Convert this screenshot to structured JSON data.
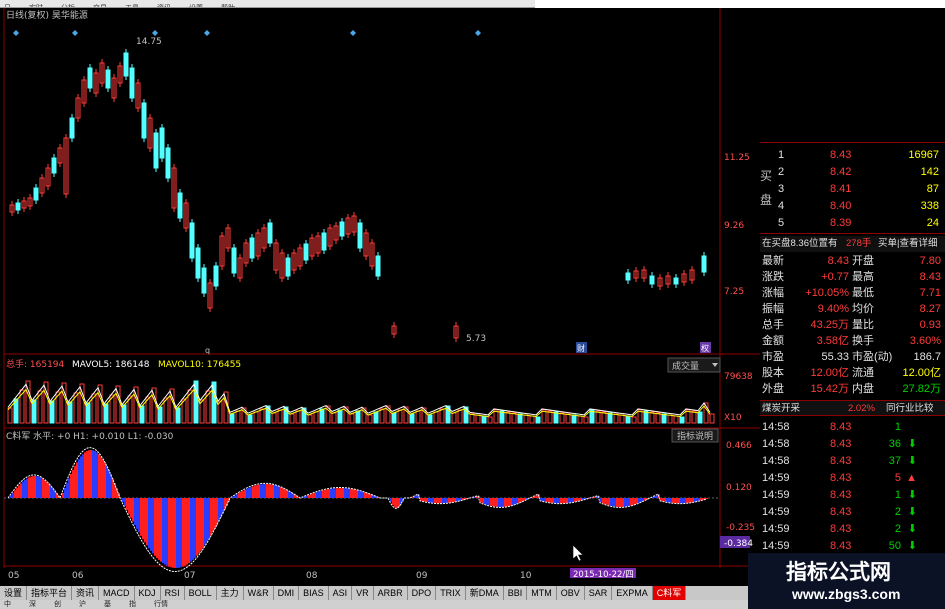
{
  "top_menu": [
    "日",
    "实时",
    "分析",
    "交易",
    "工具",
    "资讯",
    "设置",
    "帮助"
  ],
  "chart_header": {
    "title": "日线(复权) 昊华能源"
  },
  "price_labels": {
    "high": "14.75",
    "low": "5.73",
    "p1": "11.25",
    "p2": "9.26",
    "p3": "7.25"
  },
  "markers": {
    "q": "q",
    "cai": "财",
    "quan": "权"
  },
  "volume": {
    "total_label": "总手: 165194",
    "ma5_label": "MAVOL5: 186148",
    "ma10_label": "MAVOL10: 176455",
    "selector": "成交量",
    "axis_top": "79638",
    "axis_x10": "X10"
  },
  "indicator": {
    "header": "C料军 水平: +0 H1: +0.010 L1: -0.030",
    "button": "指标说明",
    "axis": [
      "0.466",
      "0.120",
      "-0.235",
      "-0.384"
    ]
  },
  "x_axis": {
    "labels": [
      "05",
      "06",
      "07",
      "08",
      "09",
      "10"
    ],
    "date_badge": "2015-10-22/四"
  },
  "tabs": [
    "设置",
    "指标平台",
    "资讯",
    "MACD",
    "KDJ",
    "RSI",
    "BOLL",
    "主力",
    "W&R",
    "DMI",
    "BIAS",
    "ASI",
    "VR",
    "ARBR",
    "DPO",
    "TRIX",
    "新DMA",
    "BBI",
    "MTM",
    "OBV",
    "SAR",
    "EXPMA",
    "C料军"
  ],
  "bottom_strip": [
    "中",
    "深",
    "创",
    "沪",
    "基",
    "指",
    "行情"
  ],
  "quote": {
    "buy_side_label": "买盘",
    "bids": [
      {
        "level": "1",
        "price": "8.43",
        "vol": "16967"
      },
      {
        "level": "2",
        "price": "8.42",
        "vol": "142"
      },
      {
        "level": "3",
        "price": "8.41",
        "vol": "87"
      },
      {
        "level": "4",
        "price": "8.40",
        "vol": "338"
      },
      {
        "level": "5",
        "price": "8.39",
        "vol": "24"
      }
    ],
    "info_line": "在买盘8.36位置有",
    "info_vol": "278手",
    "info_btn": "买单|查看详细",
    "stats": [
      {
        "l1": "最新",
        "v1": "8.43",
        "l2": "开盘",
        "v2": "7.80"
      },
      {
        "l1": "涨跌",
        "v1": "+0.77",
        "l2": "最高",
        "v2": "8.43"
      },
      {
        "l1": "涨幅",
        "v1": "+10.05%",
        "l2": "最低",
        "v2": "7.71"
      },
      {
        "l1": "振幅",
        "v1": "9.40%",
        "l2": "均价",
        "v2": "8.27"
      },
      {
        "l1": "总手",
        "v1": "43.25万",
        "l2": "量比",
        "v2": "0.93"
      },
      {
        "l1": "金额",
        "v1": "3.58亿",
        "l2": "换手",
        "v2": "3.60%"
      },
      {
        "l1": "市盈",
        "v1": "55.33",
        "l2": "市盈(动)",
        "v2": "186.7"
      },
      {
        "l1": "股本",
        "v1": "12.00亿",
        "l2": "流通",
        "v2": "12.00亿"
      },
      {
        "l1": "外盘",
        "v1": "15.42万",
        "l2": "内盘",
        "v2": "27.82万"
      }
    ],
    "news_label": "煤炭开采",
    "news_pct": "2.02%",
    "news_btn": "同行业比较",
    "ticks": [
      {
        "t": "14:58",
        "p": "8.43",
        "v": "1"
      },
      {
        "t": "14:58",
        "p": "8.43",
        "v": "36"
      },
      {
        "t": "14:58",
        "p": "8.43",
        "v": "37"
      },
      {
        "t": "14:59",
        "p": "8.43",
        "v": "5"
      },
      {
        "t": "14:59",
        "p": "8.43",
        "v": "1"
      },
      {
        "t": "14:59",
        "p": "8.43",
        "v": "2"
      },
      {
        "t": "14:59",
        "p": "8.43",
        "v": "2"
      },
      {
        "t": "14:59",
        "p": "8.43",
        "v": "50"
      }
    ]
  },
  "watermark": {
    "title": "指标公式网",
    "url": "www.zbgs3.com"
  },
  "colors": {
    "up": "#ff3b3b",
    "down": "#54ffff",
    "bg": "#000000",
    "grid": "#8b0000"
  }
}
